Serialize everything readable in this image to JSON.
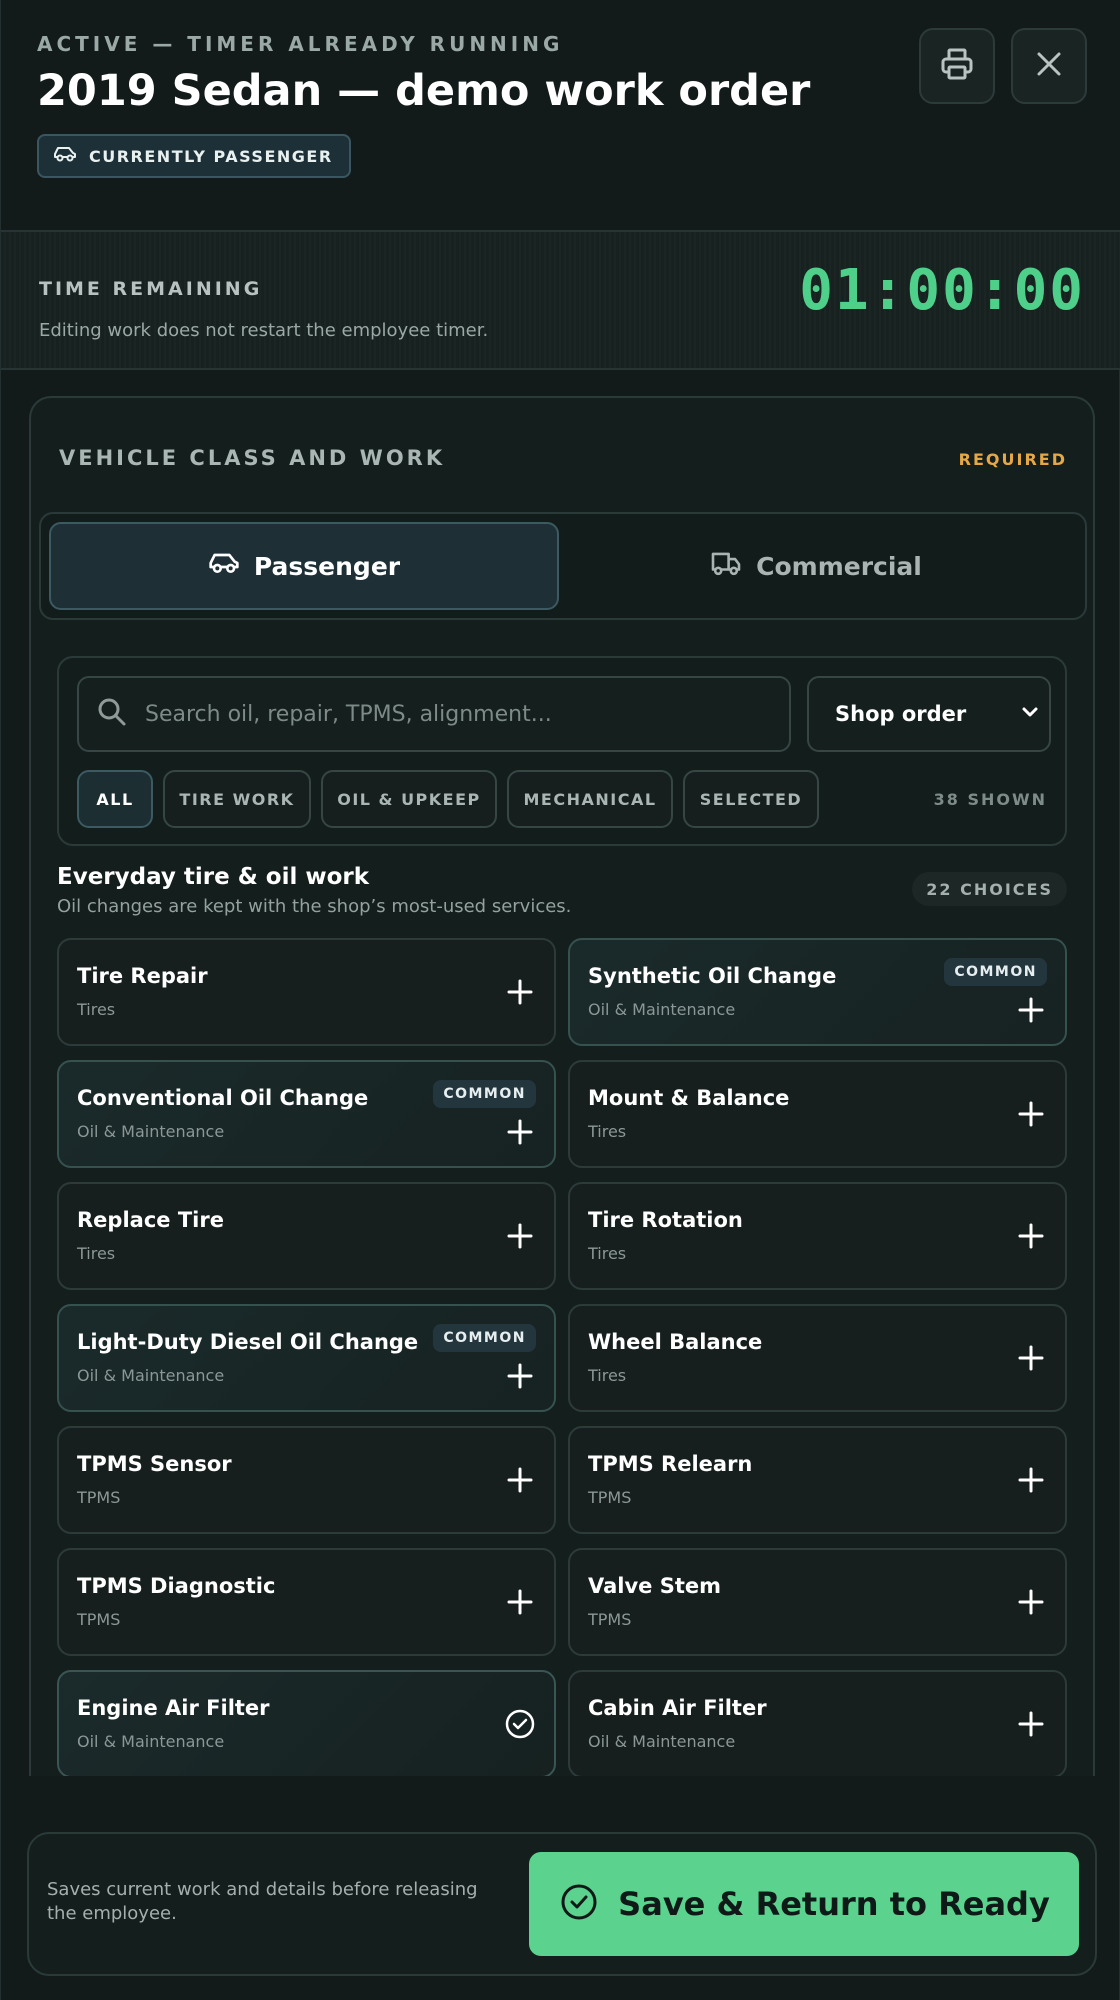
{
  "header": {
    "status": "ACTIVE — TIMER ALREADY RUNNING",
    "title": "2019 Sedan — demo work order",
    "class_badge": "CURRENTLY PASSENGER",
    "print_icon": "printer-icon",
    "close_icon": "close-icon"
  },
  "timer": {
    "label": "TIME REMAINING",
    "note": "Editing work does not restart the employee timer.",
    "value": "01:00:00"
  },
  "panel": {
    "title": "VEHICLE CLASS AND WORK",
    "required": "REQUIRED",
    "classes": [
      {
        "label": "Passenger",
        "icon": "car-icon",
        "active": true
      },
      {
        "label": "Commercial",
        "icon": "truck-icon",
        "active": false
      }
    ]
  },
  "search": {
    "placeholder": "Search oil, repair, TPMS, alignment...",
    "sort_value": "Shop order",
    "filters": [
      "ALL",
      "TIRE WORK",
      "OIL & UPKEEP",
      "MECHANICAL",
      "SELECTED"
    ],
    "active_filter": "ALL",
    "shown": "38 SHOWN"
  },
  "section": {
    "title": "Everyday tire & oil work",
    "subtitle": "Oil changes are kept with the shop’s most-used services.",
    "count": "22 CHOICES",
    "common_tag": "COMMON",
    "services": [
      {
        "name": "Tire Repair",
        "category": "Tires",
        "common": false,
        "selected": false
      },
      {
        "name": "Synthetic Oil Change",
        "category": "Oil & Maintenance",
        "common": true,
        "selected": false
      },
      {
        "name": "Conventional Oil Change",
        "category": "Oil & Maintenance",
        "common": true,
        "selected": false
      },
      {
        "name": "Mount & Balance",
        "category": "Tires",
        "common": false,
        "selected": false
      },
      {
        "name": "Replace Tire",
        "category": "Tires",
        "common": false,
        "selected": false
      },
      {
        "name": "Tire Rotation",
        "category": "Tires",
        "common": false,
        "selected": false
      },
      {
        "name": "Light-Duty Diesel Oil Change",
        "category": "Oil & Maintenance",
        "common": true,
        "selected": false
      },
      {
        "name": "Wheel Balance",
        "category": "Tires",
        "common": false,
        "selected": false
      },
      {
        "name": "TPMS Sensor",
        "category": "TPMS",
        "common": false,
        "selected": false
      },
      {
        "name": "TPMS Relearn",
        "category": "TPMS",
        "common": false,
        "selected": false
      },
      {
        "name": "TPMS Diagnostic",
        "category": "TPMS",
        "common": false,
        "selected": false
      },
      {
        "name": "Valve Stem",
        "category": "TPMS",
        "common": false,
        "selected": false
      },
      {
        "name": "Engine Air Filter",
        "category": "Oil & Maintenance",
        "common": false,
        "selected": true
      },
      {
        "name": "Cabin Air Filter",
        "category": "Oil & Maintenance",
        "common": false,
        "selected": false
      }
    ]
  },
  "footer": {
    "note": "Saves current work and details before releasing the employee.",
    "save_label": "Save & Return to Ready"
  },
  "colors": {
    "accent_green": "#5bd28e",
    "timer_green": "#4fd08a",
    "required_amber": "#e6a846",
    "background": "#121b1a"
  }
}
